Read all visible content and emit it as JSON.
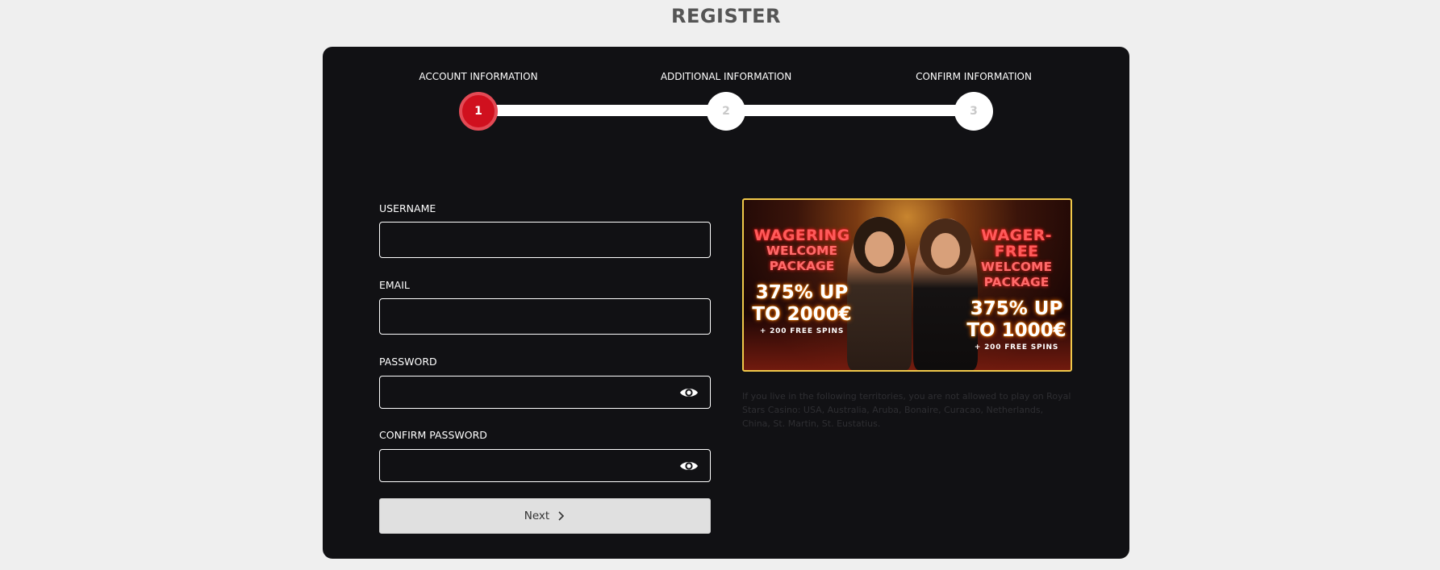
{
  "page": {
    "title": "REGISTER"
  },
  "stepper": {
    "steps": [
      {
        "label": "ACCOUNT INFORMATION",
        "number": "1",
        "active": true
      },
      {
        "label": "ADDITIONAL INFORMATION",
        "number": "2",
        "active": false
      },
      {
        "label": "CONFIRM INFORMATION",
        "number": "3",
        "active": false
      }
    ]
  },
  "form": {
    "username": {
      "label": "USERNAME",
      "value": "",
      "placeholder": ""
    },
    "email": {
      "label": "EMAIL",
      "value": "",
      "placeholder": ""
    },
    "password": {
      "label": "PASSWORD",
      "value": "",
      "placeholder": "",
      "icon": "eye-icon"
    },
    "confirm_password": {
      "label": "CONFIRM PASSWORD",
      "value": "",
      "placeholder": "",
      "icon": "eye-icon"
    },
    "next_label": "Next",
    "next_icon": "chevron-right-icon"
  },
  "banner": {
    "left": {
      "heading": "WAGERING",
      "line1": "WELCOME",
      "line2": "PACKAGE",
      "offer1": "375% UP",
      "offer2": "TO 2000€",
      "spins": "+ 200 FREE SPINS"
    },
    "right": {
      "heading": "WAGER-FREE",
      "line1": "WELCOME",
      "line2": "PACKAGE",
      "offer1": "375% UP",
      "offer2": "TO 1000€",
      "spins": "+ 200 FREE SPINS"
    }
  },
  "territory_note": "If you live in the following territories, you are not allowed to play on Royal Stars Casino: USA, Australia, Aruba, Bonaire, Curacao, Netherlands, China, St. Martin, St. Eustatius.",
  "colors": {
    "page_bg": "#efefef",
    "panel_bg": "#111114",
    "active_step": "#d0101e",
    "banner_border": "#f1c94a",
    "button_bg": "#e0e0e0"
  }
}
